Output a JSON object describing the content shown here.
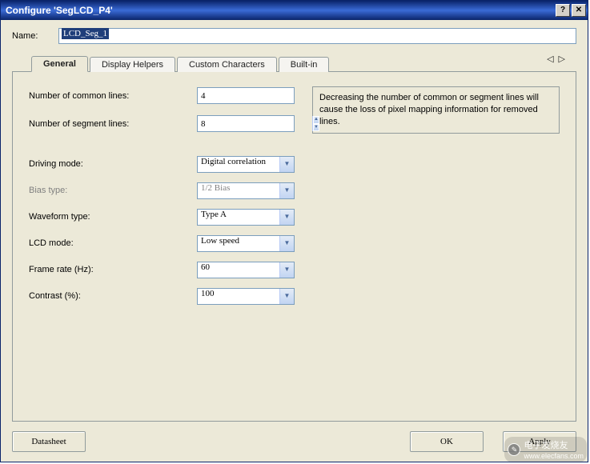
{
  "window": {
    "title": "Configure 'SegLCD_P4'"
  },
  "name_row": {
    "label": "Name:",
    "value": "LCD_Seg_1"
  },
  "tabs": {
    "items": [
      {
        "label": "General",
        "active": true
      },
      {
        "label": "Display Helpers",
        "active": false
      },
      {
        "label": "Custom Characters",
        "active": false
      },
      {
        "label": "Built-in",
        "active": false
      }
    ],
    "nav_left": "◁",
    "nav_right": "▷"
  },
  "general": {
    "common_lines_label": "Number of common lines:",
    "common_lines_value": "4",
    "segment_lines_label": "Number of segment lines:",
    "segment_lines_value": "8",
    "info_text": "Decreasing the number of common or segment lines will cause the loss of pixel mapping information for removed lines.",
    "driving_mode_label": "Driving mode:",
    "driving_mode_value": "Digital correlation",
    "bias_type_label": "Bias type:",
    "bias_type_value": "1/2 Bias",
    "waveform_label": "Waveform type:",
    "waveform_value": "Type A",
    "lcd_mode_label": "LCD mode:",
    "lcd_mode_value": "Low speed",
    "frame_rate_label": "Frame rate (Hz):",
    "frame_rate_value": "60",
    "contrast_label": "Contrast (%):",
    "contrast_value": "100"
  },
  "buttons": {
    "datasheet": "Datasheet",
    "ok": "OK",
    "apply": "Apply"
  },
  "titlebar_icons": {
    "help": "?",
    "close": "✕"
  },
  "watermark": {
    "brand": "电子发烧友",
    "url": "www.elecfans.com"
  }
}
